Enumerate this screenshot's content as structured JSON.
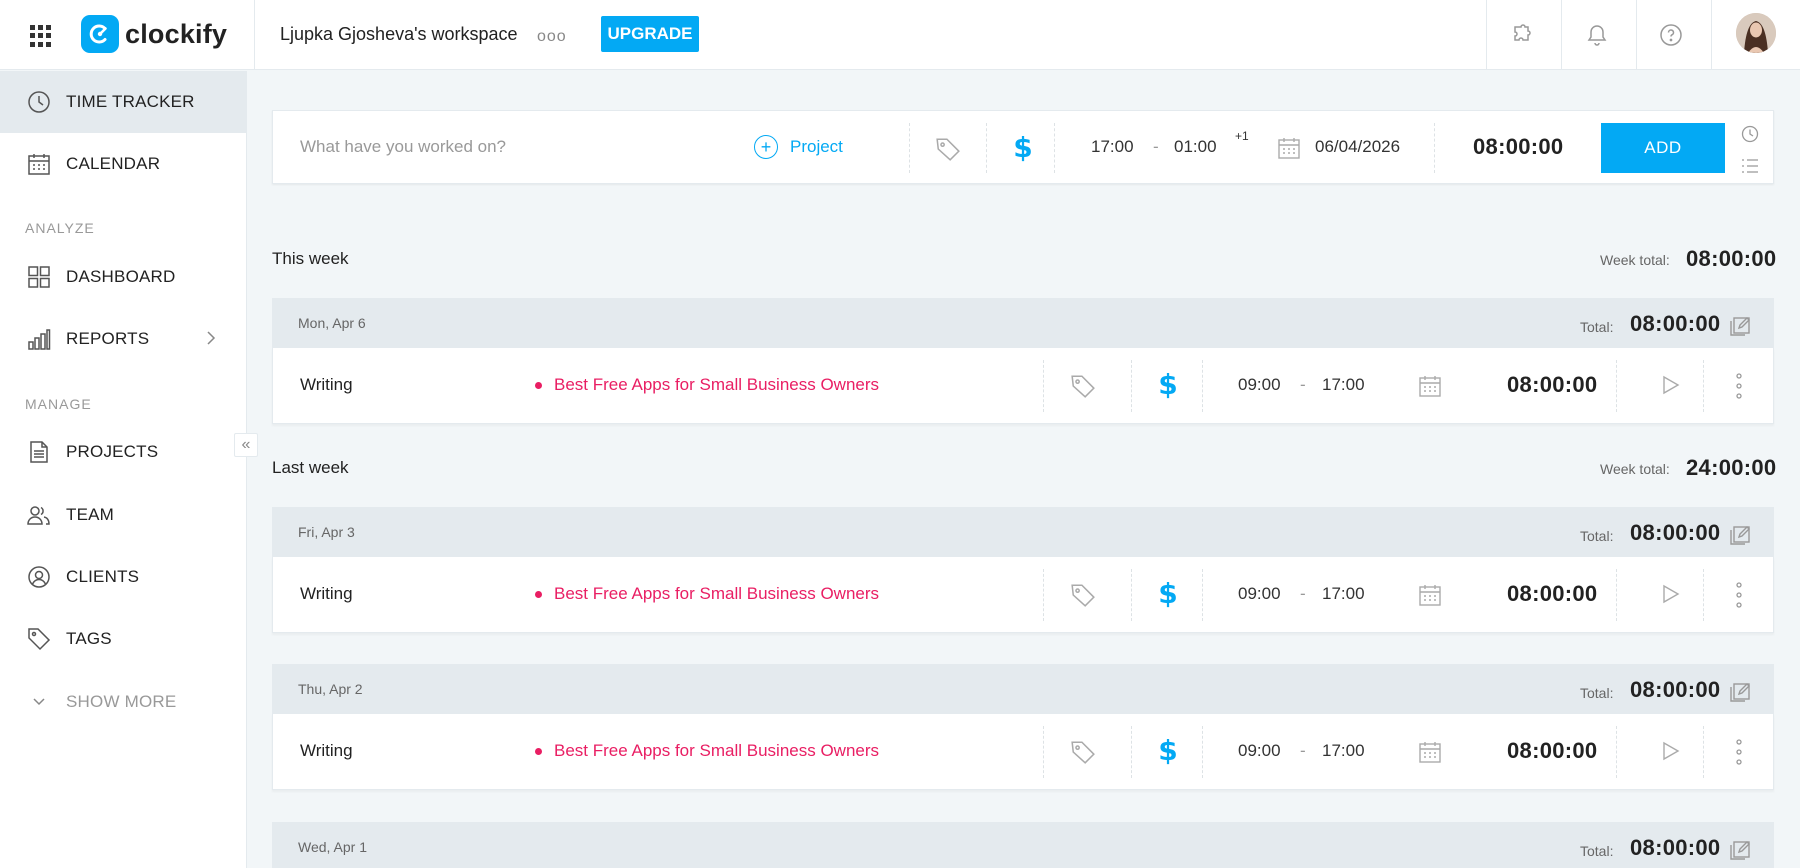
{
  "header": {
    "app_name": "clockify",
    "workspace": "Ljupka Gjosheva's workspace",
    "more": "ooo",
    "upgrade_label": "UPGRADE"
  },
  "sidebar": {
    "items": [
      {
        "label": "TIME TRACKER",
        "icon": "clock-icon",
        "active": true
      },
      {
        "label": "CALENDAR",
        "icon": "calendar-icon"
      },
      {
        "label": "DASHBOARD",
        "icon": "dashboard-icon"
      },
      {
        "label": "REPORTS",
        "icon": "bar-chart-icon"
      },
      {
        "label": "PROJECTS",
        "icon": "document-icon"
      },
      {
        "label": "TEAM",
        "icon": "team-icon"
      },
      {
        "label": "CLIENTS",
        "icon": "user-circle-icon"
      },
      {
        "label": "TAGS",
        "icon": "tag-icon"
      },
      {
        "label": "SHOW MORE",
        "icon": "chevron-down-icon"
      }
    ],
    "sections": {
      "analyze": "ANALYZE",
      "manage": "MANAGE"
    }
  },
  "timer": {
    "placeholder": "What have you worked on?",
    "project_label": "Project",
    "start": "17:00",
    "end": "01:00",
    "separator": "-",
    "next_day": "+1",
    "date": "06/04/2026",
    "duration": "08:00:00",
    "add_label": "ADD"
  },
  "weeks": [
    {
      "label": "This week",
      "total_label": "Week total:",
      "total": "08:00:00",
      "days": [
        {
          "date": "Mon, Apr 6",
          "total_label": "Total:",
          "total": "08:00:00",
          "entries": [
            {
              "description": "Writing",
              "project": "Best Free Apps for Small Business Owners",
              "start": "09:00",
              "end": "17:00",
              "separator": "-",
              "duration": "08:00:00"
            }
          ]
        }
      ]
    },
    {
      "label": "Last week",
      "total_label": "Week total:",
      "total": "24:00:00",
      "days": [
        {
          "date": "Fri, Apr 3",
          "total_label": "Total:",
          "total": "08:00:00",
          "entries": [
            {
              "description": "Writing",
              "project": "Best Free Apps for Small Business Owners",
              "start": "09:00",
              "end": "17:00",
              "separator": "-",
              "duration": "08:00:00"
            }
          ]
        },
        {
          "date": "Thu, Apr 2",
          "total_label": "Total:",
          "total": "08:00:00",
          "entries": [
            {
              "description": "Writing",
              "project": "Best Free Apps for Small Business Owners",
              "start": "09:00",
              "end": "17:00",
              "separator": "-",
              "duration": "08:00:00"
            }
          ]
        },
        {
          "date": "Wed, Apr 1",
          "total_label": "Total:",
          "total": "08:00:00",
          "entries": []
        }
      ]
    }
  ],
  "colors": {
    "accent": "#03a9f4",
    "project": "#e91e63"
  }
}
